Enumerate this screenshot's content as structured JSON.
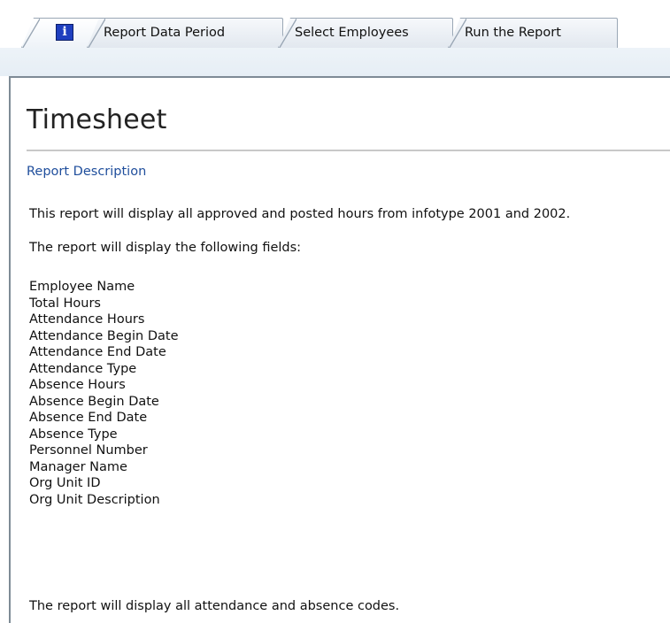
{
  "tabs": [
    {
      "label": "",
      "icon": "info-icon",
      "icon_glyph": "i"
    },
    {
      "label": "Report Data Period"
    },
    {
      "label": "Select Employees"
    },
    {
      "label": "Run the Report"
    }
  ],
  "page": {
    "title": "Timesheet",
    "section_link": "Report Description",
    "paragraph1": "This report will display all approved and posted hours from infotype 2001 and 2002.",
    "paragraph2": "The report will display the following fields:",
    "fields": [
      "Employee Name",
      "Total Hours",
      "Attendance Hours",
      "Attendance Begin Date",
      "Attendance End Date",
      "Attendance Type",
      "Absence Hours",
      "Absence Begin Date",
      "Absence End Date",
      "Absence Type",
      "Personnel Number",
      "Manager Name",
      "Org Unit ID",
      "Org Unit Description"
    ],
    "paragraph3": "The report will display all attendance and absence codes."
  },
  "colors": {
    "link": "#1f4e9c",
    "info_icon_bg": "#1f3fbf",
    "frame_border": "#7e8b96"
  }
}
